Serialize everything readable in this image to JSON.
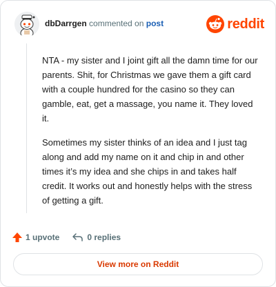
{
  "header": {
    "username": "dbDarrgen",
    "commented_text": "commented on",
    "post_link": "post",
    "brand_name": "reddit",
    "avatar_icon": "snoo-avatar-icon",
    "brand_icon": "reddit-logo-icon"
  },
  "comment": {
    "paragraphs": [
      "NTA - my sister and I joint gift all the damn time for our parents. Shit, for Christmas we gave them a gift card with a couple hundred for the casino so they can gamble, eat, get a massage, you name it. They loved it.",
      "Sometimes my sister thinks of an idea and I just tag along and add my name on it and chip in and other times it’s my idea and she chips in and takes half credit. It works out and honestly helps with the stress of getting a gift."
    ]
  },
  "actions": {
    "upvotes": "1 upvote",
    "replies": "0 replies",
    "upvote_icon": "upvote-arrow-icon",
    "reply_icon": "reply-arrow-icon"
  },
  "footer": {
    "view_more": "View more on Reddit"
  },
  "colors": {
    "brand": "#ff4500",
    "link": "#1a5fb4",
    "view_more": "#d93900",
    "muted": "#576f76",
    "border": "#dfe2e5"
  }
}
